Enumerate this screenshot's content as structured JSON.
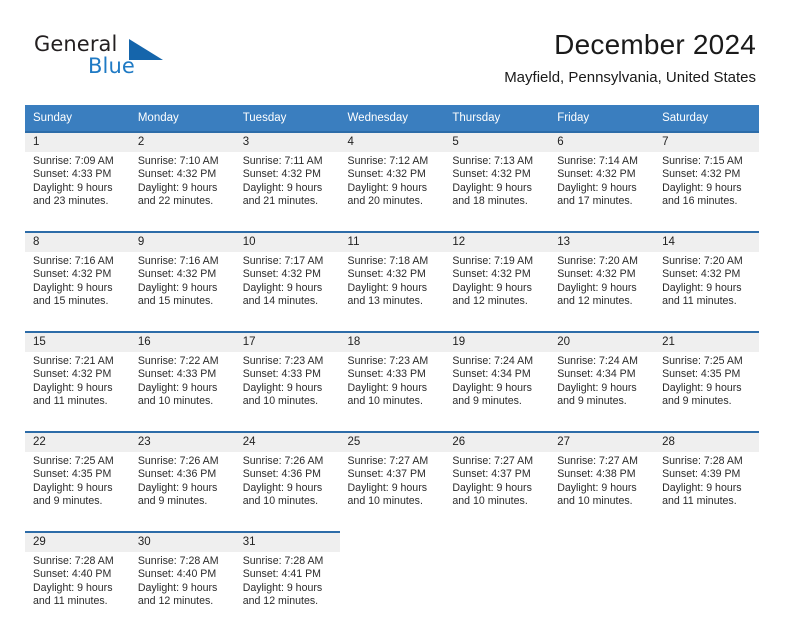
{
  "brand": {
    "word1": "General",
    "word2": "Blue",
    "logo_icon": "triangle-icon",
    "accent_color": "#1565ab",
    "blue_text_color": "#1f7ac4"
  },
  "header": {
    "title": "December 2024",
    "subtitle": "Mayfield, Pennsylvania, United States"
  },
  "calendar": {
    "header_bg": "#3a7ebf",
    "daynum_bg": "#efefef",
    "week_rule_color": "#2d6ca8",
    "weekday_names": [
      "Sunday",
      "Monday",
      "Tuesday",
      "Wednesday",
      "Thursday",
      "Friday",
      "Saturday"
    ],
    "weeks": [
      {
        "days": [
          {
            "num": "1",
            "sunrise": "Sunrise: 7:09 AM",
            "sunset": "Sunset: 4:33 PM",
            "daylight1": "Daylight: 9 hours",
            "daylight2": "and 23 minutes."
          },
          {
            "num": "2",
            "sunrise": "Sunrise: 7:10 AM",
            "sunset": "Sunset: 4:32 PM",
            "daylight1": "Daylight: 9 hours",
            "daylight2": "and 22 minutes."
          },
          {
            "num": "3",
            "sunrise": "Sunrise: 7:11 AM",
            "sunset": "Sunset: 4:32 PM",
            "daylight1": "Daylight: 9 hours",
            "daylight2": "and 21 minutes."
          },
          {
            "num": "4",
            "sunrise": "Sunrise: 7:12 AM",
            "sunset": "Sunset: 4:32 PM",
            "daylight1": "Daylight: 9 hours",
            "daylight2": "and 20 minutes."
          },
          {
            "num": "5",
            "sunrise": "Sunrise: 7:13 AM",
            "sunset": "Sunset: 4:32 PM",
            "daylight1": "Daylight: 9 hours",
            "daylight2": "and 18 minutes."
          },
          {
            "num": "6",
            "sunrise": "Sunrise: 7:14 AM",
            "sunset": "Sunset: 4:32 PM",
            "daylight1": "Daylight: 9 hours",
            "daylight2": "and 17 minutes."
          },
          {
            "num": "7",
            "sunrise": "Sunrise: 7:15 AM",
            "sunset": "Sunset: 4:32 PM",
            "daylight1": "Daylight: 9 hours",
            "daylight2": "and 16 minutes."
          }
        ]
      },
      {
        "days": [
          {
            "num": "8",
            "sunrise": "Sunrise: 7:16 AM",
            "sunset": "Sunset: 4:32 PM",
            "daylight1": "Daylight: 9 hours",
            "daylight2": "and 15 minutes."
          },
          {
            "num": "9",
            "sunrise": "Sunrise: 7:16 AM",
            "sunset": "Sunset: 4:32 PM",
            "daylight1": "Daylight: 9 hours",
            "daylight2": "and 15 minutes."
          },
          {
            "num": "10",
            "sunrise": "Sunrise: 7:17 AM",
            "sunset": "Sunset: 4:32 PM",
            "daylight1": "Daylight: 9 hours",
            "daylight2": "and 14 minutes."
          },
          {
            "num": "11",
            "sunrise": "Sunrise: 7:18 AM",
            "sunset": "Sunset: 4:32 PM",
            "daylight1": "Daylight: 9 hours",
            "daylight2": "and 13 minutes."
          },
          {
            "num": "12",
            "sunrise": "Sunrise: 7:19 AM",
            "sunset": "Sunset: 4:32 PM",
            "daylight1": "Daylight: 9 hours",
            "daylight2": "and 12 minutes."
          },
          {
            "num": "13",
            "sunrise": "Sunrise: 7:20 AM",
            "sunset": "Sunset: 4:32 PM",
            "daylight1": "Daylight: 9 hours",
            "daylight2": "and 12 minutes."
          },
          {
            "num": "14",
            "sunrise": "Sunrise: 7:20 AM",
            "sunset": "Sunset: 4:32 PM",
            "daylight1": "Daylight: 9 hours",
            "daylight2": "and 11 minutes."
          }
        ]
      },
      {
        "days": [
          {
            "num": "15",
            "sunrise": "Sunrise: 7:21 AM",
            "sunset": "Sunset: 4:32 PM",
            "daylight1": "Daylight: 9 hours",
            "daylight2": "and 11 minutes."
          },
          {
            "num": "16",
            "sunrise": "Sunrise: 7:22 AM",
            "sunset": "Sunset: 4:33 PM",
            "daylight1": "Daylight: 9 hours",
            "daylight2": "and 10 minutes."
          },
          {
            "num": "17",
            "sunrise": "Sunrise: 7:23 AM",
            "sunset": "Sunset: 4:33 PM",
            "daylight1": "Daylight: 9 hours",
            "daylight2": "and 10 minutes."
          },
          {
            "num": "18",
            "sunrise": "Sunrise: 7:23 AM",
            "sunset": "Sunset: 4:33 PM",
            "daylight1": "Daylight: 9 hours",
            "daylight2": "and 10 minutes."
          },
          {
            "num": "19",
            "sunrise": "Sunrise: 7:24 AM",
            "sunset": "Sunset: 4:34 PM",
            "daylight1": "Daylight: 9 hours",
            "daylight2": "and 9 minutes."
          },
          {
            "num": "20",
            "sunrise": "Sunrise: 7:24 AM",
            "sunset": "Sunset: 4:34 PM",
            "daylight1": "Daylight: 9 hours",
            "daylight2": "and 9 minutes."
          },
          {
            "num": "21",
            "sunrise": "Sunrise: 7:25 AM",
            "sunset": "Sunset: 4:35 PM",
            "daylight1": "Daylight: 9 hours",
            "daylight2": "and 9 minutes."
          }
        ]
      },
      {
        "days": [
          {
            "num": "22",
            "sunrise": "Sunrise: 7:25 AM",
            "sunset": "Sunset: 4:35 PM",
            "daylight1": "Daylight: 9 hours",
            "daylight2": "and 9 minutes."
          },
          {
            "num": "23",
            "sunrise": "Sunrise: 7:26 AM",
            "sunset": "Sunset: 4:36 PM",
            "daylight1": "Daylight: 9 hours",
            "daylight2": "and 9 minutes."
          },
          {
            "num": "24",
            "sunrise": "Sunrise: 7:26 AM",
            "sunset": "Sunset: 4:36 PM",
            "daylight1": "Daylight: 9 hours",
            "daylight2": "and 10 minutes."
          },
          {
            "num": "25",
            "sunrise": "Sunrise: 7:27 AM",
            "sunset": "Sunset: 4:37 PM",
            "daylight1": "Daylight: 9 hours",
            "daylight2": "and 10 minutes."
          },
          {
            "num": "26",
            "sunrise": "Sunrise: 7:27 AM",
            "sunset": "Sunset: 4:37 PM",
            "daylight1": "Daylight: 9 hours",
            "daylight2": "and 10 minutes."
          },
          {
            "num": "27",
            "sunrise": "Sunrise: 7:27 AM",
            "sunset": "Sunset: 4:38 PM",
            "daylight1": "Daylight: 9 hours",
            "daylight2": "and 10 minutes."
          },
          {
            "num": "28",
            "sunrise": "Sunrise: 7:28 AM",
            "sunset": "Sunset: 4:39 PM",
            "daylight1": "Daylight: 9 hours",
            "daylight2": "and 11 minutes."
          }
        ]
      },
      {
        "days": [
          {
            "num": "29",
            "sunrise": "Sunrise: 7:28 AM",
            "sunset": "Sunset: 4:40 PM",
            "daylight1": "Daylight: 9 hours",
            "daylight2": "and 11 minutes."
          },
          {
            "num": "30",
            "sunrise": "Sunrise: 7:28 AM",
            "sunset": "Sunset: 4:40 PM",
            "daylight1": "Daylight: 9 hours",
            "daylight2": "and 12 minutes."
          },
          {
            "num": "31",
            "sunrise": "Sunrise: 7:28 AM",
            "sunset": "Sunset: 4:41 PM",
            "daylight1": "Daylight: 9 hours",
            "daylight2": "and 12 minutes."
          },
          {
            "num": "",
            "sunrise": "",
            "sunset": "",
            "daylight1": "",
            "daylight2": ""
          },
          {
            "num": "",
            "sunrise": "",
            "sunset": "",
            "daylight1": "",
            "daylight2": ""
          },
          {
            "num": "",
            "sunrise": "",
            "sunset": "",
            "daylight1": "",
            "daylight2": ""
          },
          {
            "num": "",
            "sunrise": "",
            "sunset": "",
            "daylight1": "",
            "daylight2": ""
          }
        ]
      }
    ]
  }
}
